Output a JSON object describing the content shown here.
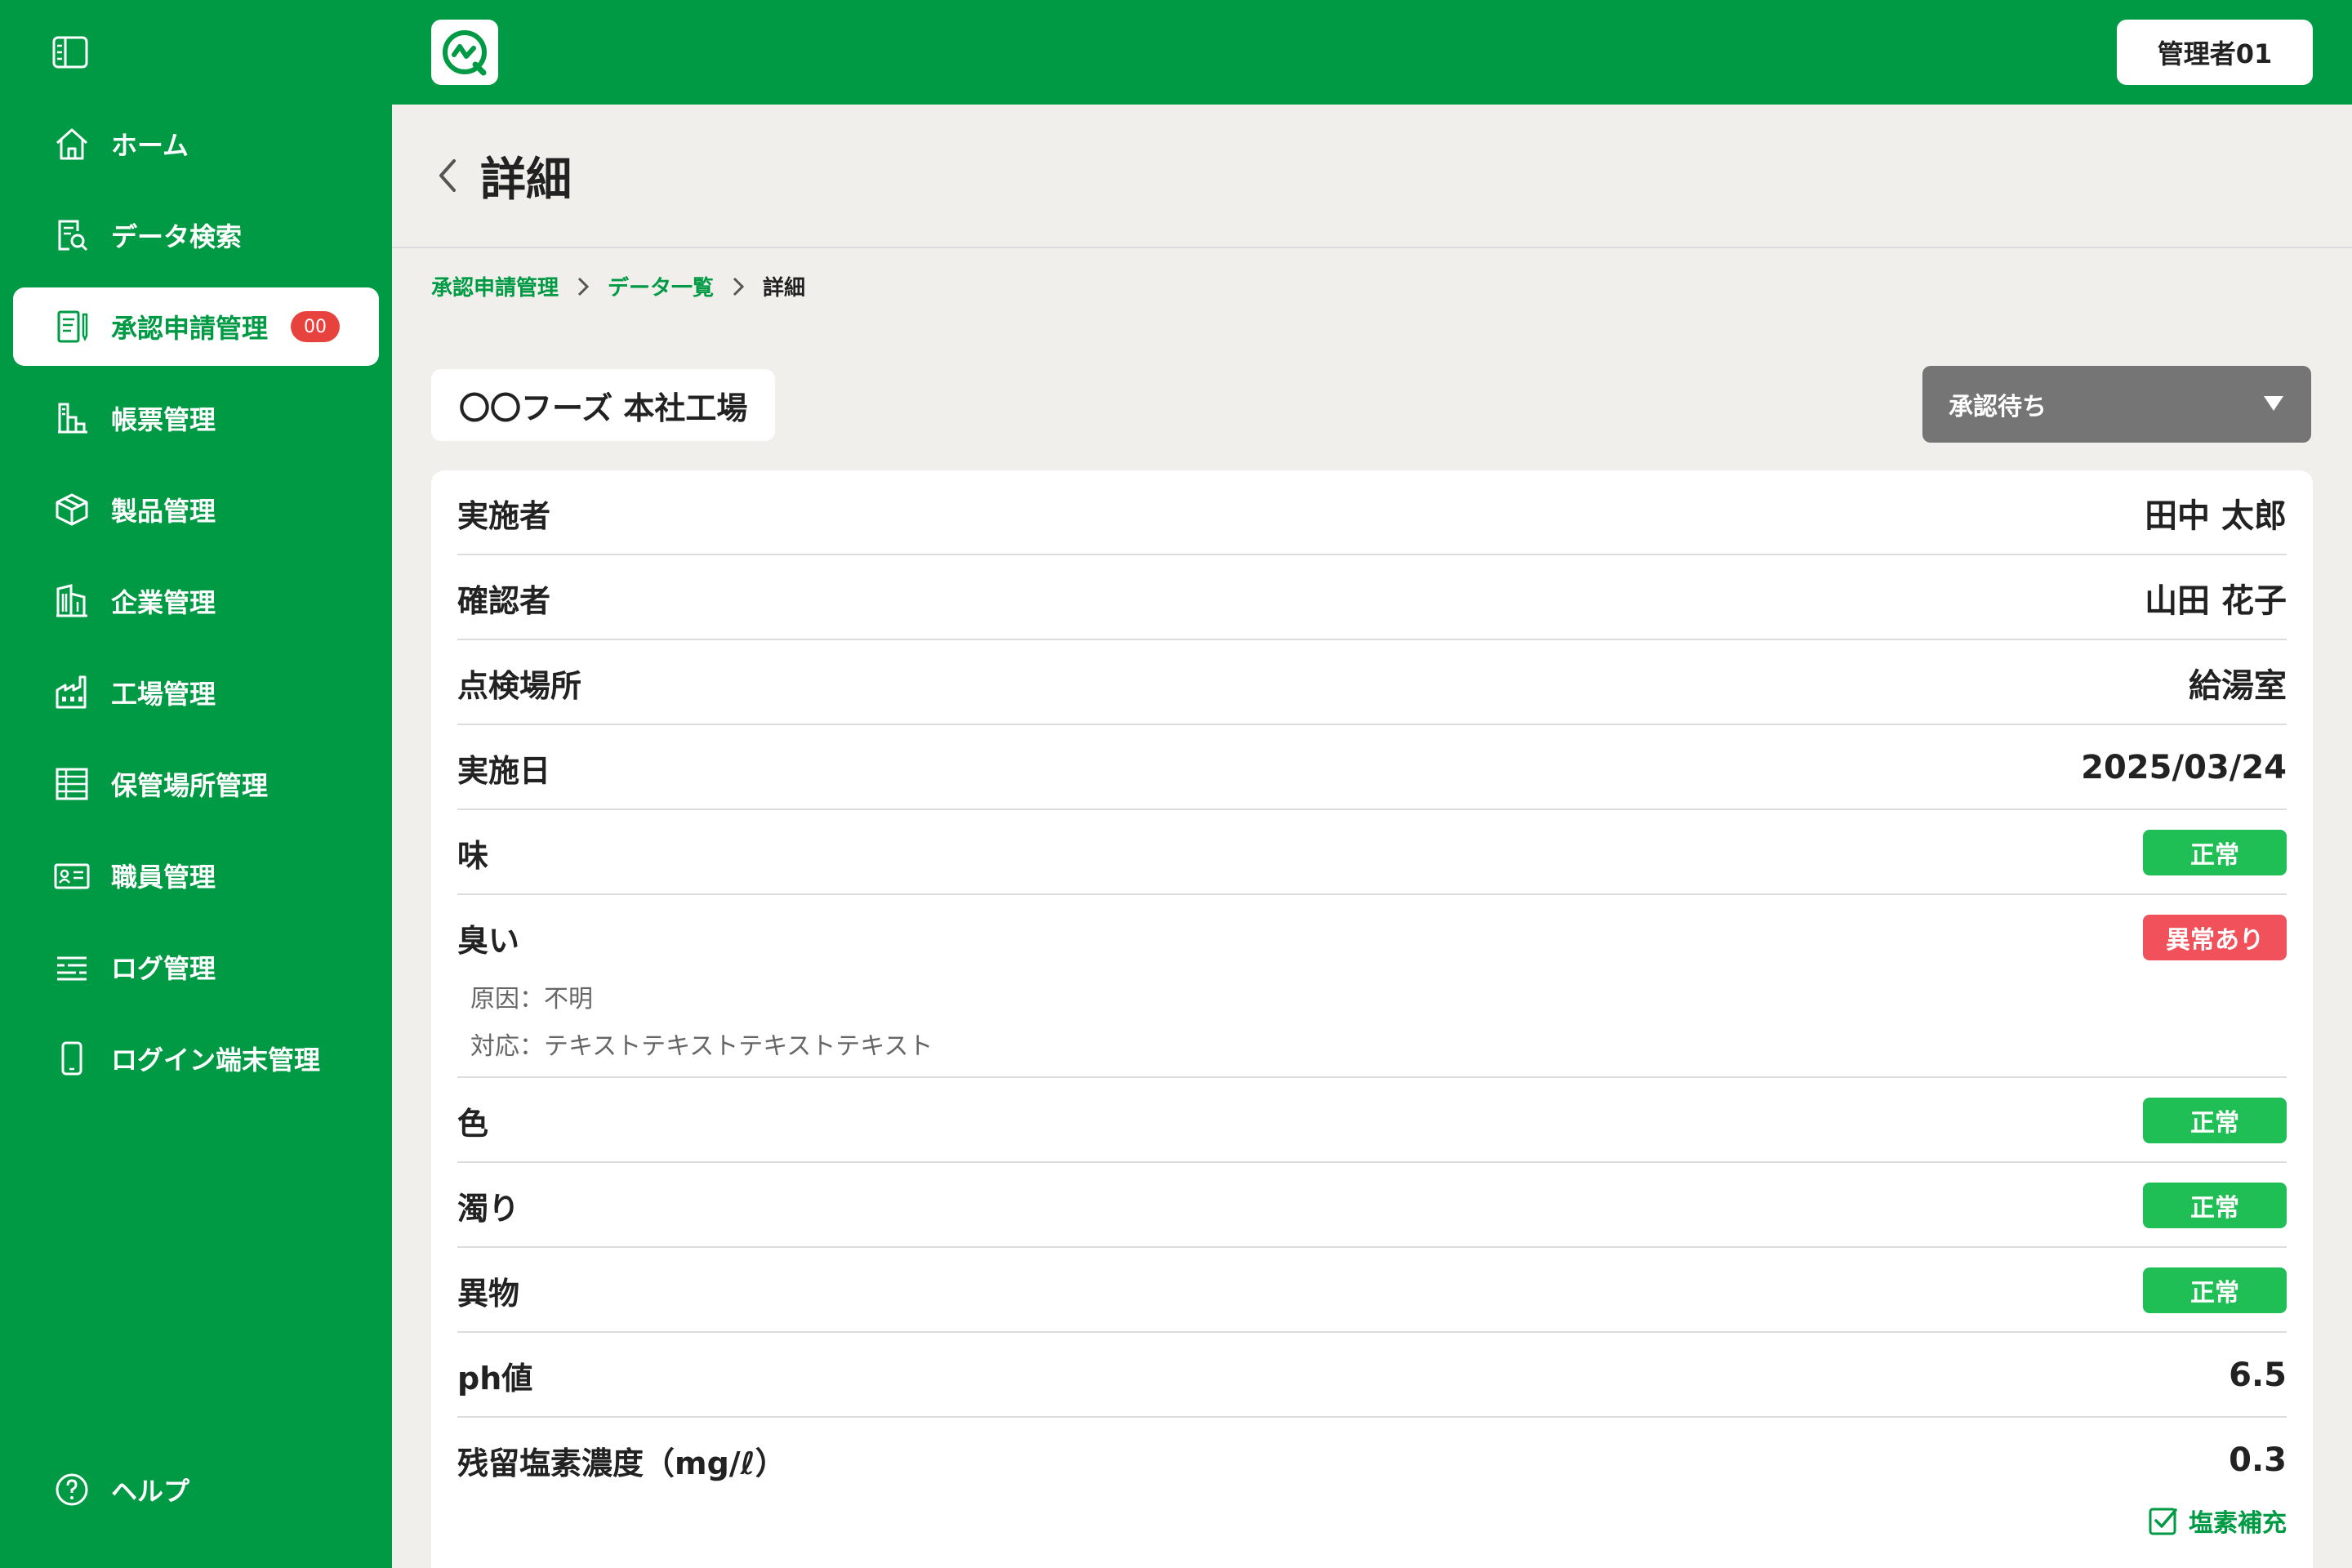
{
  "sidebar": {
    "items": [
      {
        "label": "ホーム",
        "icon": "home-icon"
      },
      {
        "label": "データ検索",
        "icon": "data-search-icon"
      },
      {
        "label": "承認申請管理",
        "icon": "approval-icon",
        "badge": "00",
        "active": true
      },
      {
        "label": "帳票管理",
        "icon": "report-icon"
      },
      {
        "label": "製品管理",
        "icon": "box-icon"
      },
      {
        "label": "企業管理",
        "icon": "building-icon"
      },
      {
        "label": "工場管理",
        "icon": "factory-icon"
      },
      {
        "label": "保管場所管理",
        "icon": "storage-icon"
      },
      {
        "label": "職員管理",
        "icon": "id-card-icon"
      },
      {
        "label": "ログ管理",
        "icon": "log-icon"
      },
      {
        "label": "ログイン端末管理",
        "icon": "device-icon"
      }
    ],
    "help_label": "ヘルプ"
  },
  "header": {
    "user": "管理者01"
  },
  "page": {
    "title": "詳細"
  },
  "breadcrumb": [
    "承認申請管理",
    "データ一覧",
    "詳細"
  ],
  "facility": "〇〇フーズ 本社工場",
  "status": {
    "selected": "承認待ち"
  },
  "details": {
    "performer": {
      "label": "実施者",
      "value": "田中 太郎"
    },
    "confirmer": {
      "label": "確認者",
      "value": "山田 花子"
    },
    "location": {
      "label": "点検場所",
      "value": "給湯室"
    },
    "date": {
      "label": "実施日",
      "value": "2025/03/24"
    },
    "taste": {
      "label": "味",
      "value": "正常"
    },
    "smell": {
      "label": "臭い",
      "value": "異常あり",
      "cause": "原因：不明",
      "action": "対応：テキストテキストテキストテキスト"
    },
    "color": {
      "label": "色",
      "value": "正常"
    },
    "turbidity": {
      "label": "濁り",
      "value": "正常"
    },
    "foreign": {
      "label": "異物",
      "value": "正常"
    },
    "ph": {
      "label": "ph値",
      "value": "6.5"
    },
    "chlorine": {
      "label": "残留塩素濃度（mg/ℓ）",
      "value": "0.3",
      "supplement": "塩素補充"
    }
  },
  "colors": {
    "brand": "#009a44",
    "ok": "#1fbf55",
    "ng": "#f0515a",
    "select": "#757575"
  }
}
